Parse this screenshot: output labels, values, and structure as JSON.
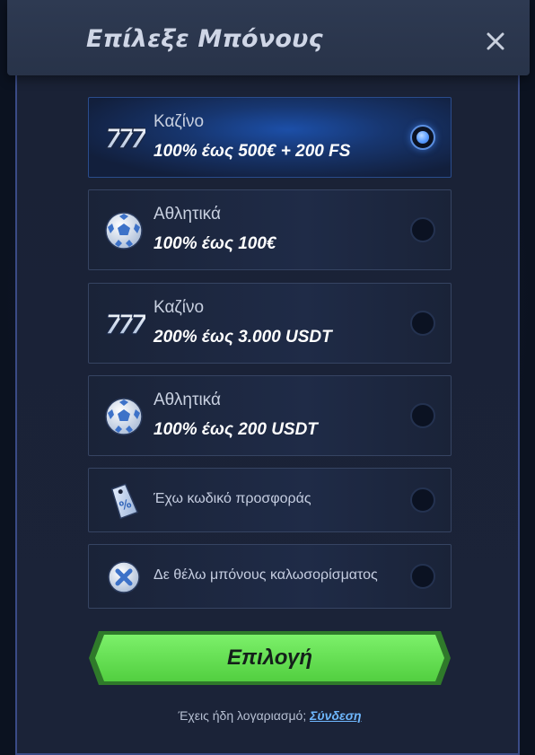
{
  "header": {
    "title": "Επίλεξε Μπόνους",
    "close_icon": "close-icon"
  },
  "options": [
    {
      "icon": "slot-777-icon",
      "title": "Καζίνο",
      "subtitle": "100% έως 500€ + 200 FS",
      "selected": true
    },
    {
      "icon": "soccer-ball-icon",
      "title": "Αθλητικά",
      "subtitle": "100% έως 100€",
      "selected": false
    },
    {
      "icon": "slot-777-icon",
      "title": "Καζίνο",
      "subtitle": "200% έως 3.000 USDT",
      "selected": false
    },
    {
      "icon": "soccer-ball-icon",
      "title": "Αθλητικά",
      "subtitle": "100% έως 200 USDT",
      "selected": false
    },
    {
      "icon": "promo-tag-icon",
      "label": "Έχω κωδικό προσφοράς",
      "selected": false
    },
    {
      "icon": "no-bonus-icon",
      "label": "Δε θέλω μπόνους καλωσορίσματος",
      "selected": false
    }
  ],
  "cta": {
    "label": "Επιλογή"
  },
  "footer": {
    "text": "Έχεις ήδη λογαριασμό;",
    "link": "Σύνδεση"
  },
  "colors": {
    "accent_green": "#63e051",
    "link_blue": "#6fb8ff",
    "selected_blue": "#1c4fa8",
    "radio_on": "#5b9dff"
  }
}
